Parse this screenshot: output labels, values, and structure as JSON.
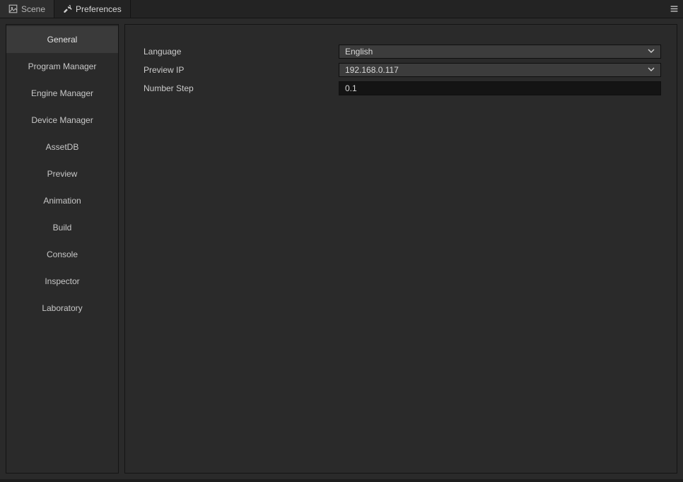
{
  "tabs": {
    "scene": {
      "label": "Scene"
    },
    "preferences": {
      "label": "Preferences"
    }
  },
  "sidebar": {
    "items": [
      {
        "id": "general",
        "label": "General",
        "active": true
      },
      {
        "id": "program-manager",
        "label": "Program Manager"
      },
      {
        "id": "engine-manager",
        "label": "Engine Manager"
      },
      {
        "id": "device-manager",
        "label": "Device Manager"
      },
      {
        "id": "assetdb",
        "label": "AssetDB"
      },
      {
        "id": "preview",
        "label": "Preview"
      },
      {
        "id": "animation",
        "label": "Animation"
      },
      {
        "id": "build",
        "label": "Build"
      },
      {
        "id": "console",
        "label": "Console"
      },
      {
        "id": "inspector",
        "label": "Inspector"
      },
      {
        "id": "laboratory",
        "label": "Laboratory"
      }
    ]
  },
  "form": {
    "language": {
      "label": "Language",
      "value": "English"
    },
    "preview_ip": {
      "label": "Preview IP",
      "value": "192.168.0.117"
    },
    "number_step": {
      "label": "Number Step",
      "value": "0.1"
    }
  }
}
